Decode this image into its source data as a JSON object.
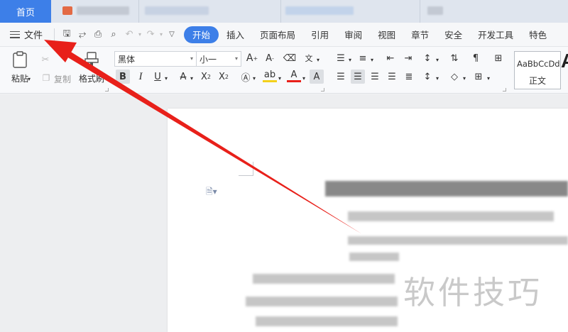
{
  "tabbar": {
    "home_label": "首页"
  },
  "menubar": {
    "file_label": "文件",
    "items": [
      "开始",
      "插入",
      "页面布局",
      "引用",
      "审阅",
      "视图",
      "章节",
      "安全",
      "开发工具",
      "特色"
    ],
    "active_index": 0
  },
  "ribbon": {
    "clipboard": {
      "paste_label": "粘贴",
      "copy_label": "复制",
      "format_painter_label": "格式刷"
    },
    "font": {
      "family_value": "黑体",
      "size_value": "小一"
    },
    "styles": {
      "sample_text": "AaBbCcDd",
      "style_name": "正文"
    }
  },
  "document": {
    "watermark_text": "软件技巧"
  },
  "colors": {
    "accent": "#3d7fe8",
    "arrow": "#e8201a"
  }
}
